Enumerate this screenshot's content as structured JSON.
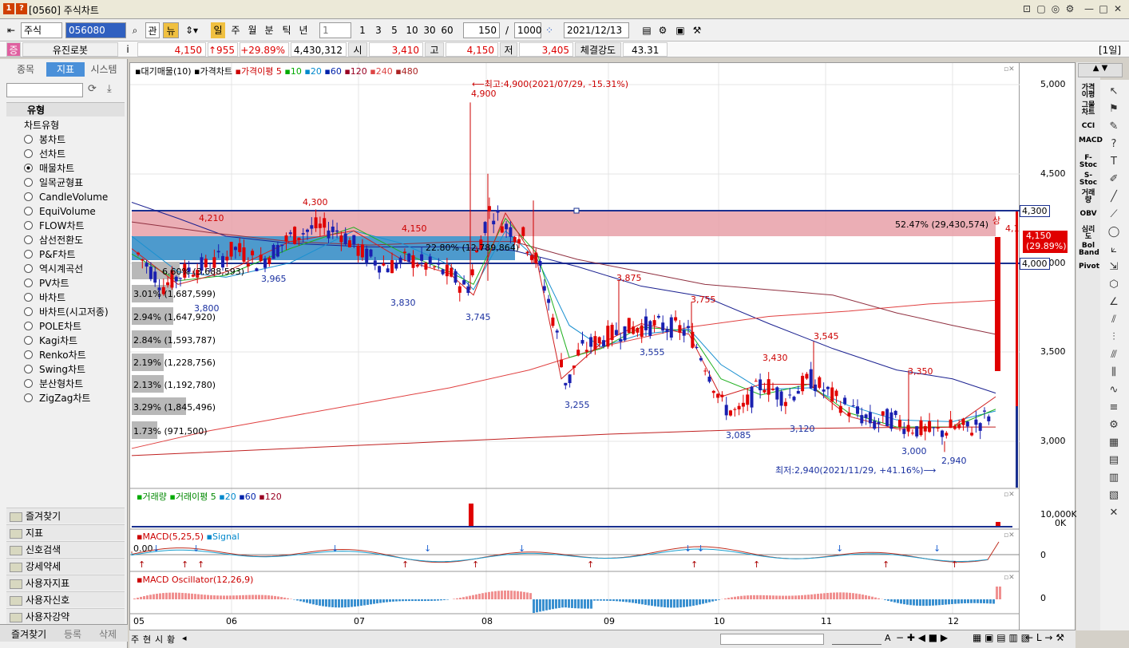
{
  "window": {
    "title": "[0560] 주식차트",
    "btn1": "1",
    "btn2": "?"
  },
  "window_controls": [
    "⊡",
    "▢",
    "◎",
    "⚙",
    "—",
    "□",
    "✕"
  ],
  "toolbar": {
    "market": "주식",
    "code": "056080",
    "btn_gwan": "관",
    "btn_news": "뉴",
    "periods": [
      "일",
      "주",
      "월",
      "분",
      "틱",
      "년"
    ],
    "interval_value": "1",
    "intervals": [
      "1",
      "3",
      "5",
      "10",
      "30",
      "60"
    ],
    "count": "150",
    "slash": "/",
    "total": "1000",
    "date": "2021/12/13"
  },
  "pricebar": {
    "badge": "증",
    "name": "유진로봇",
    "info": "i",
    "price": "4,150",
    "change": "↑955",
    "rate": "+29.89%",
    "volume": "4,430,312",
    "open_label": "시",
    "open": "3,410",
    "high_label": "고",
    "high": "4,150",
    "low_label": "저",
    "low": "3,405",
    "strength_label": "체결강도",
    "strength": "43.31",
    "period": "[1일]"
  },
  "left": {
    "tabs": [
      "종목",
      "지표",
      "시스템"
    ],
    "group": "유형",
    "folder": "차트유형",
    "types": [
      "봉차트",
      "선차트",
      "매물차트",
      "일목균형표",
      "CandleVolume",
      "EquiVolume",
      "FLOW차트",
      "삼선전환도",
      "P&F차트",
      "역시계곡선",
      "PV차트",
      "바차트",
      "바차트(시고저종)",
      "POLE차트",
      "Kagi차트",
      "Renko차트",
      "Swing차트",
      "분산형차트",
      "ZigZag차트"
    ],
    "selected": "매물차트",
    "folders": [
      "즐겨찾기",
      "지표",
      "신호검색",
      "강세약세",
      "사용자지표",
      "사용자신호",
      "사용자강약"
    ],
    "bottom_tabs": [
      "즐겨찾기",
      "등록",
      "삭제"
    ]
  },
  "chart": {
    "legend": {
      "a": "대기매물(10)",
      "b": "가격차트",
      "c": "가격이평 5",
      "d": "10",
      "e": "20",
      "f": "60",
      "g": "120",
      "h": "240",
      "i": "480"
    },
    "high_note": "⟵최고:4,900(2021/07/29, -15.31%)",
    "low_note": "최저:2,940(2021/11/29, +41.16%)⟶",
    "labels": [
      "4,900",
      "4,300",
      "4,210",
      "4,150",
      "3,965",
      "3,800",
      "3,830",
      "3,745",
      "3,875",
      "3,755",
      "3,555",
      "3,255",
      "3,430",
      "3,545",
      "3,085",
      "3,120",
      "3,350",
      "3,000",
      "2,940",
      "상",
      "4,150"
    ],
    "volume_profile": [
      "22.80% (12,789,864)",
      "52.47% (29,430,574)",
      "6.60% (3,688,593)",
      "3.01% (1,687,599)",
      "2.94% (1,647,920)",
      "2.84% (1,593,787)",
      "2.19% (1,228,756)",
      "2.13% (1,192,780)",
      "3.29% (1,845,496)",
      "1.73% (971,500)"
    ],
    "vol_legend": {
      "a": "거래량",
      "b": "거래이평 5",
      "c": "20",
      "d": "60",
      "e": "120"
    },
    "macd_legend": {
      "a": "MACD(5,25,5)",
      "b": "Signal"
    },
    "macd_zero": "0.00",
    "osc_legend": "MACD Oscillator(12,26,9)",
    "months": [
      "05",
      "06",
      "07",
      "08",
      "09",
      "10",
      "11",
      "12"
    ]
  },
  "yaxis": {
    "ticks": [
      "5,000",
      "4,500",
      "4,000",
      "3,500",
      "3,000"
    ],
    "tag_4300": "4,300",
    "tag_4000": "4,000",
    "cur_price": "4,150",
    "cur_rate": "(29.89%)",
    "vol_tick": "10,000K",
    "vol_zero": "0K",
    "macd_zero": "0",
    "osc_zero": "0"
  },
  "right_tools": [
    "가격이평",
    "그물차트",
    "CCI",
    "MACD",
    "F-Stoc",
    "S-Stoc",
    "거래량",
    "OBV",
    "심리도",
    "Bol Band",
    "Pivot"
  ],
  "bottom": {
    "tabs": [
      "주",
      "현",
      "시",
      "황"
    ],
    "zoom": "A"
  },
  "chart_data": {
    "type": "candlestick",
    "x": [
      "05",
      "06",
      "07",
      "08",
      "09",
      "10",
      "11",
      "12"
    ],
    "ylim": [
      2800,
      5000
    ],
    "annotations": {
      "high": 4900,
      "low": 2940,
      "last": 4150
    },
    "resistance_lines": [
      4300,
      4000
    ]
  }
}
